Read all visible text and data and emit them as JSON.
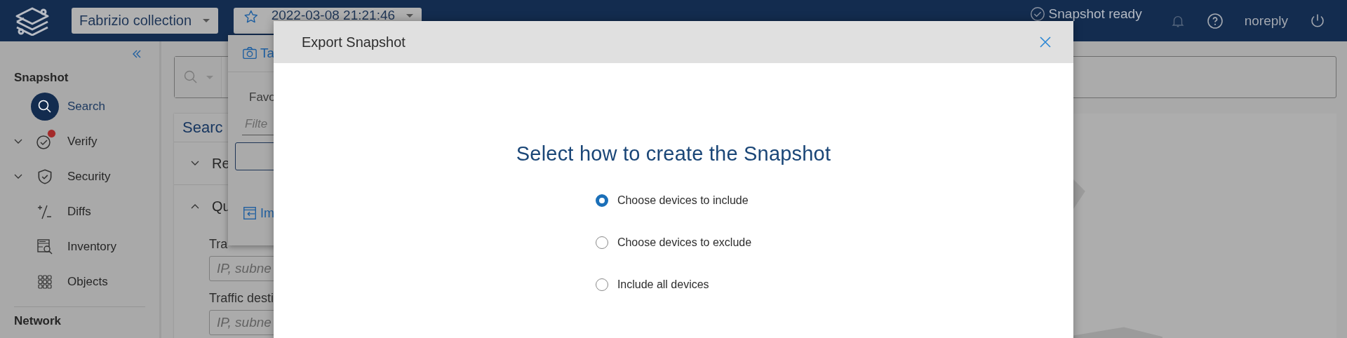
{
  "top_bar": {
    "collection": "Fabrizio collection",
    "snapshot": "2022-03-08  21:21:46",
    "status": "Snapshot ready",
    "user": "noreply"
  },
  "sidebar": {
    "sections": [
      {
        "title": "Snapshot",
        "items": [
          {
            "label": "Search",
            "kind": "link",
            "selected": true,
            "alert": false
          },
          {
            "label": "Verify",
            "kind": "group",
            "selected": false,
            "alert": true
          },
          {
            "label": "Security",
            "kind": "group",
            "selected": false,
            "alert": false
          },
          {
            "label": "Diffs",
            "kind": "link",
            "selected": false,
            "alert": false
          },
          {
            "label": "Inventory",
            "kind": "link",
            "selected": false,
            "alert": false
          },
          {
            "label": "Objects",
            "kind": "link",
            "selected": false,
            "alert": false
          }
        ]
      },
      {
        "title": "Network"
      }
    ]
  },
  "search_panel": {
    "title": "Searc",
    "sections": [
      {
        "label": "Re",
        "expanded": false
      },
      {
        "label": "Qu",
        "expanded": true
      }
    ],
    "fields": [
      {
        "label": "Tra",
        "placeholder": "IP, subne"
      },
      {
        "label": "Traffic desti",
        "placeholder": "IP, subne"
      }
    ]
  },
  "snapshot_menu": {
    "take_label": "Ta",
    "favorites_label": "Favo",
    "filter_placeholder": "Filte",
    "import_label": "Im"
  },
  "modal": {
    "title": "Export Snapshot",
    "heading": "Select how to create the Snapshot",
    "options": [
      {
        "label": "Choose devices to include",
        "selected": true
      },
      {
        "label": "Choose devices to exclude",
        "selected": false
      },
      {
        "label": "Include all devices",
        "selected": false
      }
    ]
  }
}
